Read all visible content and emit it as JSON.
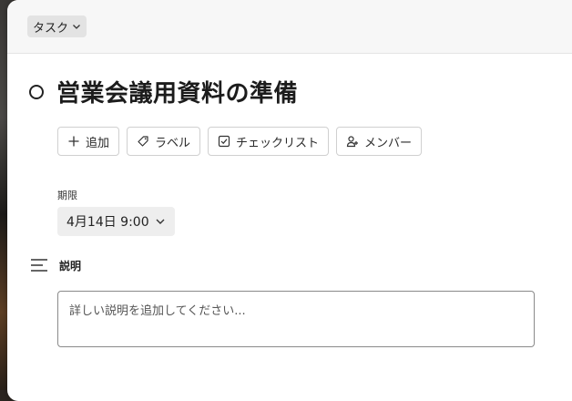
{
  "header": {
    "type_selector": "タスク"
  },
  "task": {
    "title": "営業会議用資料の準備"
  },
  "actions": [
    {
      "label": "追加",
      "icon": "plus-icon"
    },
    {
      "label": "ラベル",
      "icon": "tag-icon"
    },
    {
      "label": "チェックリスト",
      "icon": "checkbox-icon"
    },
    {
      "label": "メンバー",
      "icon": "add-member-icon"
    }
  ],
  "due": {
    "label": "期限",
    "value": "4月14日 9:00"
  },
  "description": {
    "label": "説明",
    "placeholder": "詳しい説明を追加してください..."
  },
  "colors": {
    "topbar_bg": "#f7f7f7",
    "pill_bg": "#e3e3e3",
    "due_bg": "#eeeeee",
    "text": "#1c1c1c"
  }
}
